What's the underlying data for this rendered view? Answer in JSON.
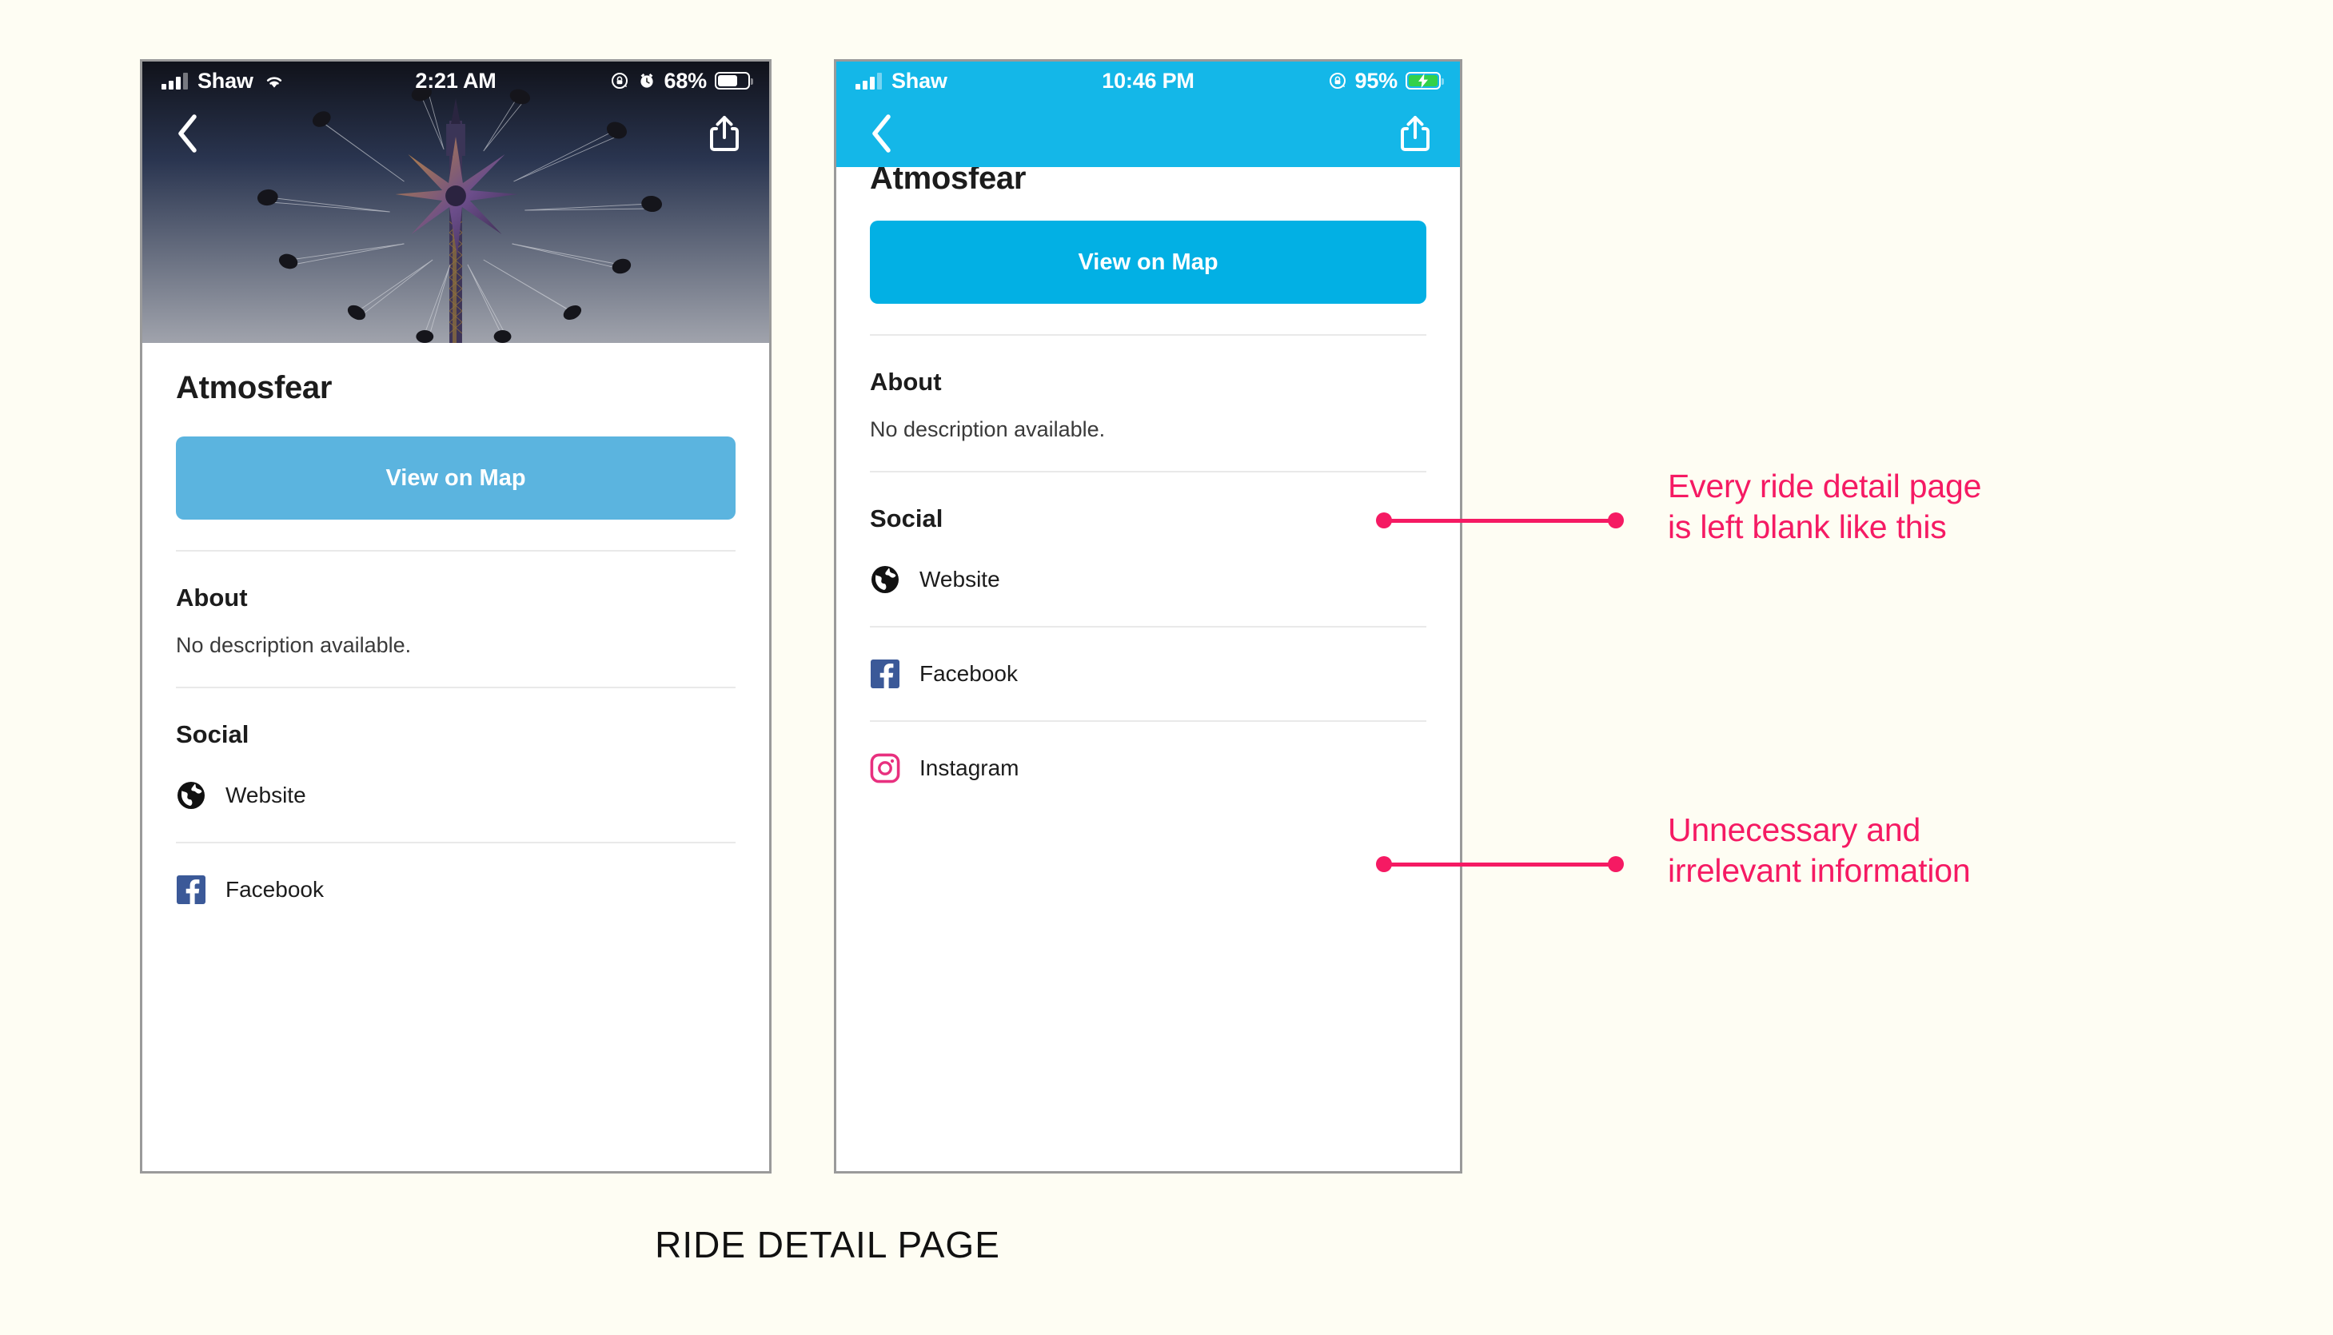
{
  "canvas": {
    "background_color": "#FEFDF3",
    "caption": "RIDE DETAIL PAGE"
  },
  "phones": [
    {
      "id": "left",
      "status_bar": {
        "carrier": "Shaw",
        "time": "2:21 AM",
        "battery_percent": "68%",
        "icons": [
          "signal-icon",
          "wifi-icon",
          "rotation-lock-icon",
          "alarm-icon",
          "battery-icon"
        ],
        "charging": false
      },
      "nav": {
        "back_icon": "chevron-left-icon",
        "share_icon": "share-icon",
        "style": "transparent-over-photo"
      },
      "hero": {
        "alt": "swing carousel ride at dusk",
        "visible": true
      },
      "title": "Atmosfear",
      "map_button": {
        "label": "View on Map",
        "color": "#5BB4DF"
      },
      "about": {
        "heading": "About",
        "body": "No description available."
      },
      "social": {
        "heading": "Social",
        "items": [
          {
            "label": "Website",
            "icon": "globe-icon",
            "color": "#111111"
          },
          {
            "label": "Facebook",
            "icon": "facebook-icon",
            "color": "#3B5998",
            "clipped": true
          }
        ]
      }
    },
    {
      "id": "right",
      "status_bar": {
        "carrier": "Shaw",
        "time": "10:46 PM",
        "battery_percent": "95%",
        "icons": [
          "signal-icon",
          "rotation-lock-icon",
          "battery-charging-icon"
        ],
        "charging": true
      },
      "nav": {
        "back_icon": "chevron-left-icon",
        "share_icon": "share-icon",
        "style": "cyan-bar",
        "bar_color": "#14B7E8"
      },
      "hero": {
        "alt": "",
        "visible": false
      },
      "title": "Atmosfear",
      "map_button": {
        "label": "View on Map",
        "color": "#02B0E4"
      },
      "about": {
        "heading": "About",
        "body": "No description available."
      },
      "social": {
        "heading": "Social",
        "items": [
          {
            "label": "Website",
            "icon": "globe-icon",
            "color": "#111111"
          },
          {
            "label": "Facebook",
            "icon": "facebook-icon",
            "color": "#3B5998"
          },
          {
            "label": "Instagram",
            "icon": "instagram-icon",
            "color": "#E8307F"
          }
        ]
      }
    }
  ],
  "annotations": {
    "color": "#F51A63",
    "items": [
      {
        "text": "Every ride detail page\nis left blank like this"
      },
      {
        "text": "Unnecessary and\nirrelevant information"
      }
    ]
  }
}
